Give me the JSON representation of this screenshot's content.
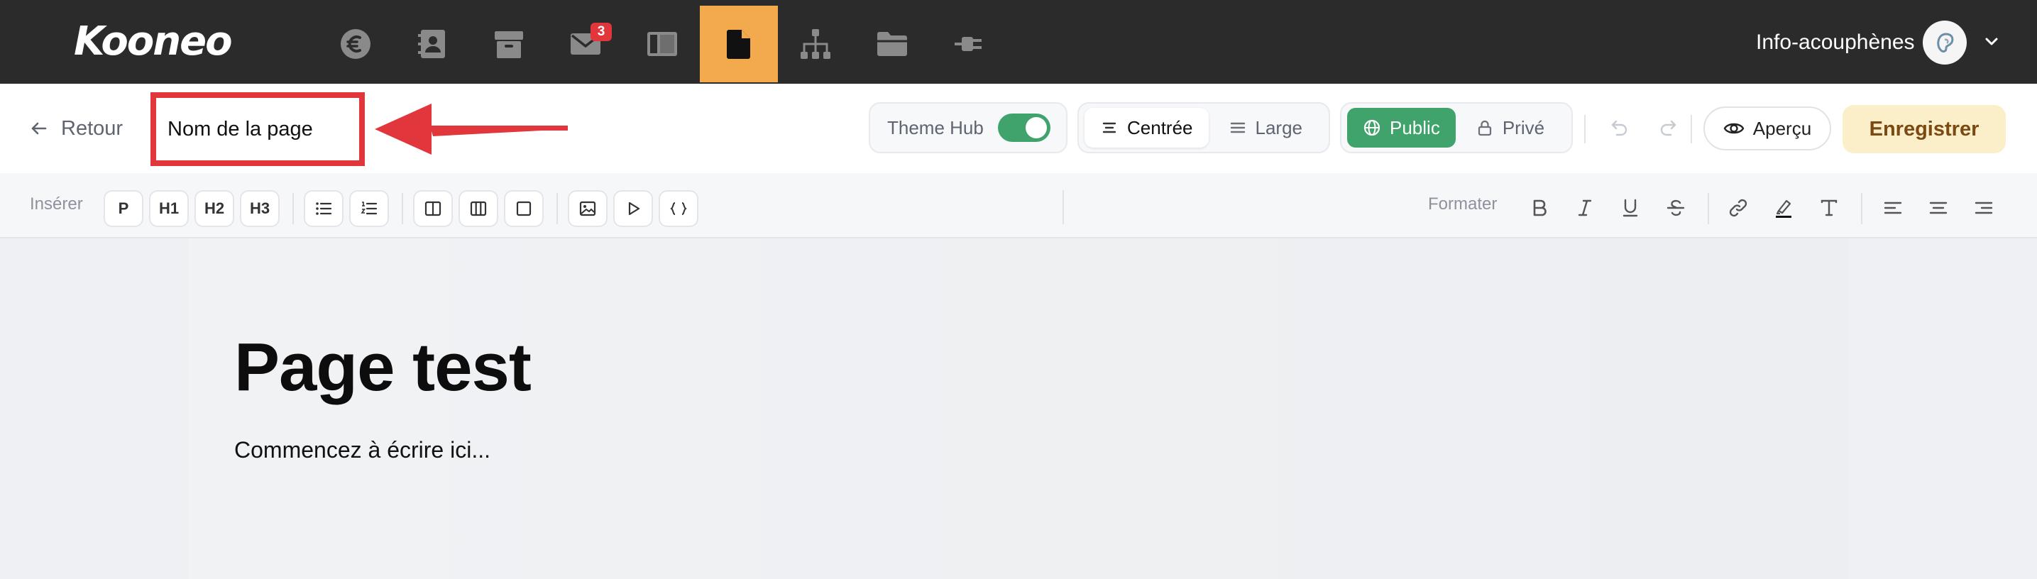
{
  "app": {
    "logo": "Kooneo"
  },
  "topnav": {
    "items": [
      {
        "icon": "euro-icon"
      },
      {
        "icon": "contacts-icon"
      },
      {
        "icon": "product-box-icon"
      },
      {
        "icon": "mail-icon",
        "badge": "3"
      },
      {
        "icon": "layout-icon"
      },
      {
        "icon": "pages-icon",
        "active": true
      },
      {
        "icon": "sitemap-icon"
      },
      {
        "icon": "folder-icon"
      },
      {
        "icon": "plugin-icon"
      }
    ],
    "account_name": "Info-acouphènes"
  },
  "header": {
    "back_label": "Retour",
    "page_name_value": "Nom de la page",
    "theme_hub_label": "Theme Hub",
    "theme_hub_on": true,
    "layout_options": [
      {
        "label": "Centrée",
        "selected": true
      },
      {
        "label": "Large",
        "selected": false
      }
    ],
    "visibility_options": [
      {
        "label": "Public",
        "selected": true
      },
      {
        "label": "Privé",
        "selected": false
      }
    ],
    "preview_label": "Aperçu",
    "save_label": "Enregistrer"
  },
  "toolbar": {
    "insert_label": "Insérer",
    "insert_buttons": [
      "P",
      "H1",
      "H2",
      "H3"
    ],
    "format_label": "Formater"
  },
  "editor": {
    "title": "Page test",
    "body": "Commencez à écrire ici..."
  },
  "colors": {
    "topbar": "#2b2b2b",
    "active_nav": "#f2aa4c",
    "accent_green": "#3fa36b",
    "annotation_red": "#e0363c",
    "save_bg": "#fbefc9"
  }
}
